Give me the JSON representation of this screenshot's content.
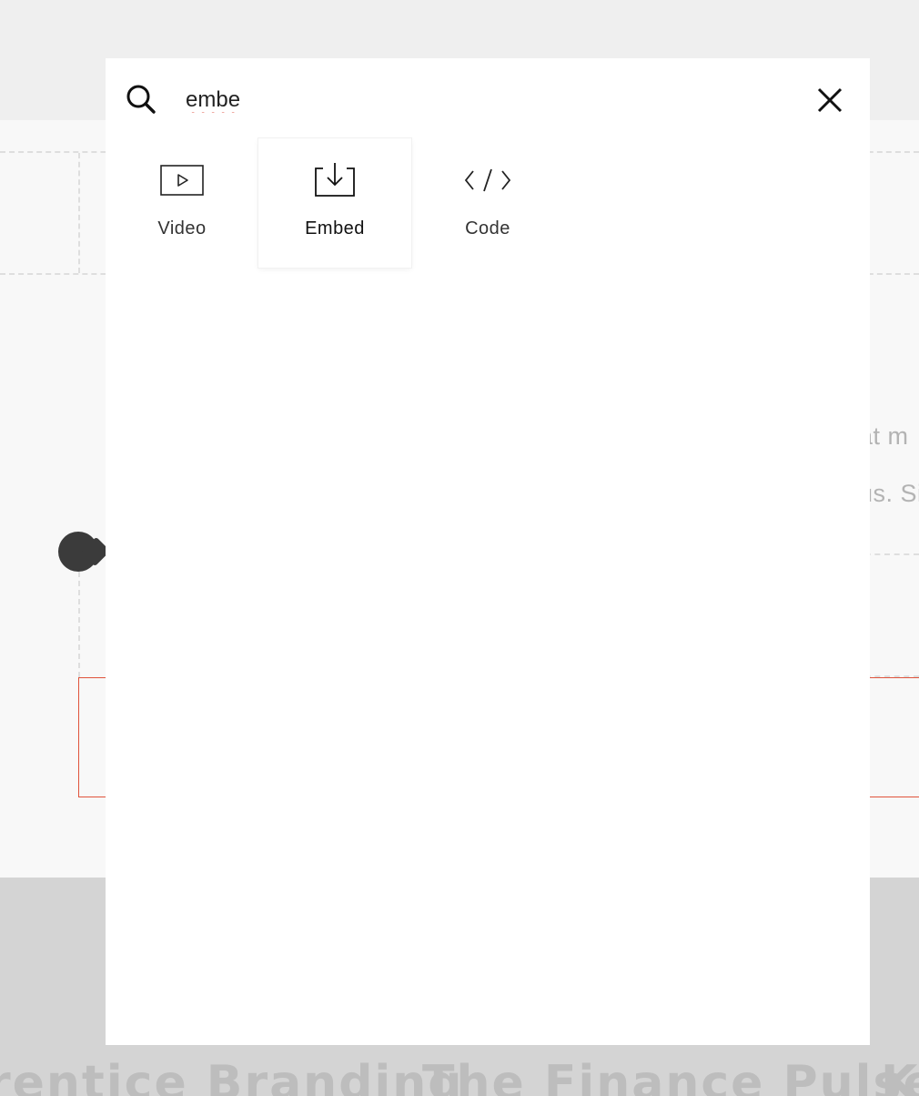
{
  "background": {
    "snippet_line_1": "at m",
    "snippet_line_2": "us. Si",
    "footer_titles": [
      "rentice Branding",
      "The Finance Pulse",
      "Ki"
    ]
  },
  "search": {
    "value": "embe",
    "placeholder": ""
  },
  "results": [
    {
      "label": "Video",
      "icon": "video-icon",
      "active": false
    },
    {
      "label": "Embed",
      "icon": "embed-icon",
      "active": true
    },
    {
      "label": "Code",
      "icon": "code-icon",
      "active": false
    }
  ],
  "colors": {
    "accent_red": "#e0533b",
    "overlay_bg": "#efefef",
    "modal_bg": "#ffffff"
  }
}
